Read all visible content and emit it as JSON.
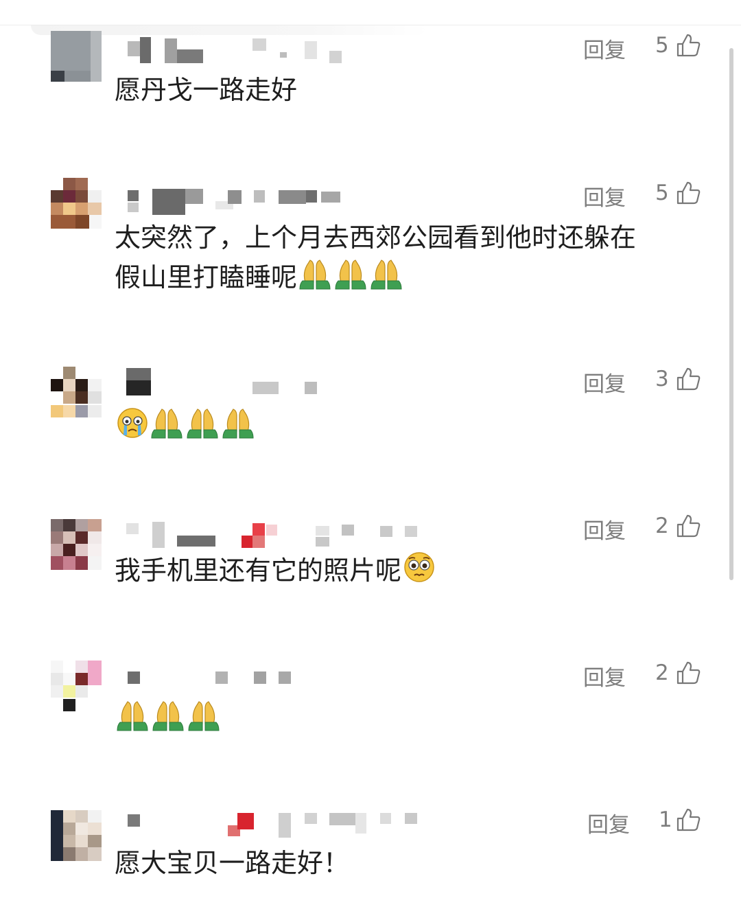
{
  "comments": [
    {
      "text": "愿丹戈一路走好",
      "reply": "回复",
      "likes": "5"
    },
    {
      "text_line1": "太突然了，上个月去西郊公园看到他时还躲在",
      "text_line2": "假山里打瞌睡呢",
      "reply": "回复",
      "likes": "5"
    },
    {
      "reply": "回复",
      "likes": "3"
    },
    {
      "text": "我手机里还有它的照片呢",
      "reply": "回复",
      "likes": "2"
    },
    {
      "reply": "回复",
      "likes": "2"
    },
    {
      "text": "愿大宝贝一路走好！",
      "reply": "回复",
      "likes": "1"
    }
  ],
  "icons": {
    "like": "thumbs-up-icon",
    "pray": "folded-hands-emoji",
    "cry": "crying-face-emoji",
    "pleading": "pleading-face-emoji"
  },
  "colors": {
    "meta": "#7d7d7d",
    "text": "#1e1e1e"
  }
}
